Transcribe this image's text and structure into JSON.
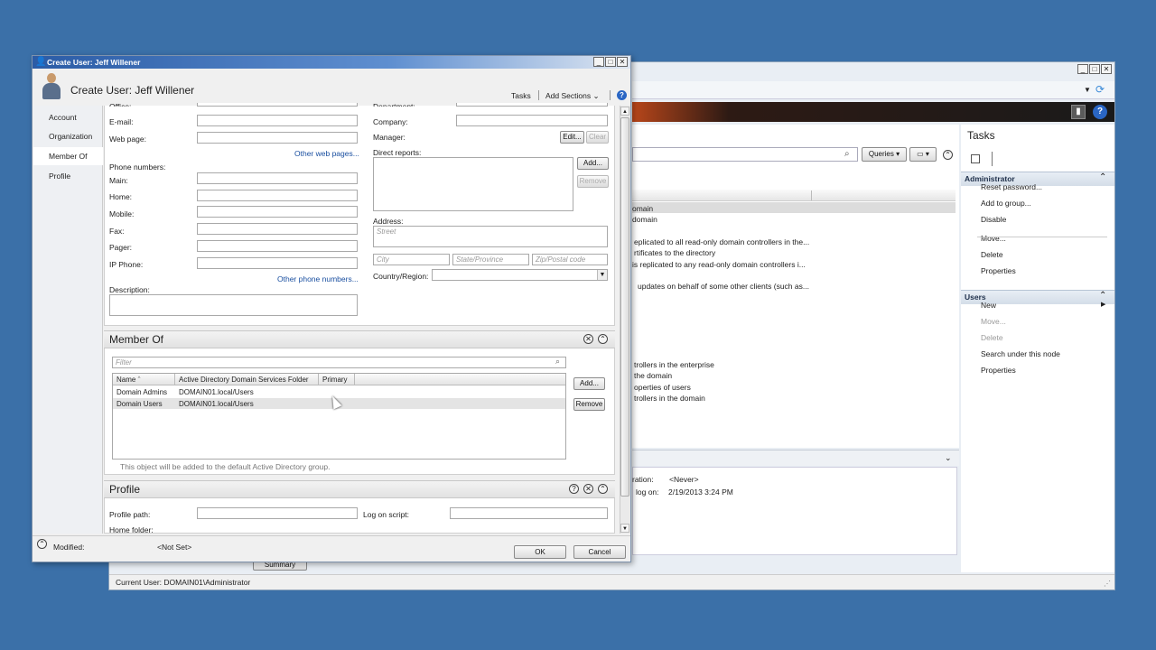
{
  "background_window": {
    "tasks_title": "Tasks",
    "search_icon": "magnifier-icon",
    "queries_label": "Queries",
    "list_items": [
      "omain",
      "domain",
      "eplicated to all read-only domain controllers in the...",
      "rtificates to the directory",
      "is replicated to any read-only domain controllers i...",
      "updates on behalf of some other clients (such as...",
      "trollers in the enterprise",
      "the domain",
      "operties of users",
      "trollers in the domain"
    ],
    "details": [
      {
        "label": "ration:",
        "value": "<Never>"
      },
      {
        "label": "log on:",
        "value": "2/19/2013 3:24 PM"
      }
    ],
    "summary_button": "Summary",
    "status_bar": "Current User: DOMAIN01\\Administrator",
    "task_groups": [
      {
        "title": "Administrator",
        "items": [
          {
            "label": "Reset password...",
            "enabled": true
          },
          {
            "label": "Add to group...",
            "enabled": true
          },
          {
            "label": "Disable",
            "enabled": true
          },
          {
            "label": "Move...",
            "enabled": true
          },
          {
            "label": "Delete",
            "enabled": true
          },
          {
            "label": "Properties",
            "enabled": true
          }
        ]
      },
      {
        "title": "Users",
        "items": [
          {
            "label": "New",
            "enabled": true
          },
          {
            "label": "Move...",
            "enabled": false
          },
          {
            "label": "Delete",
            "enabled": false
          },
          {
            "label": "Search under this node",
            "enabled": true
          },
          {
            "label": "Properties",
            "enabled": true
          }
        ]
      }
    ]
  },
  "dialog": {
    "window_title": "Create User: Jeff Willener",
    "header_title": "Create User: Jeff Willener",
    "tasks_menu": "Tasks",
    "add_sections_menu": "Add Sections",
    "nav": [
      "Account",
      "Organization",
      "Member Of",
      "Profile"
    ],
    "nav_active": "Member Of",
    "org": {
      "office_label": "Office:",
      "email_label": "E-mail:",
      "webpage_label": "Web page:",
      "other_web_pages": "Other web pages...",
      "phone_numbers_label": "Phone numbers:",
      "main_label": "Main:",
      "home_label": "Home:",
      "mobile_label": "Mobile:",
      "fax_label": "Fax:",
      "pager_label": "Pager:",
      "ipphone_label": "IP Phone:",
      "other_phone_numbers": "Other phone numbers...",
      "description_label": "Description:",
      "department_label": "Department:",
      "company_label": "Company:",
      "manager_label": "Manager:",
      "edit_button": "Edit...",
      "clear_button": "Clear",
      "direct_reports_label": "Direct reports:",
      "add_button": "Add...",
      "remove_button": "Remove",
      "address_label": "Address:",
      "street_placeholder": "Street",
      "city_placeholder": "City",
      "state_placeholder": "State/Province",
      "zip_placeholder": "Zip/Postal code",
      "country_label": "Country/Region:"
    },
    "member_of": {
      "title": "Member Of",
      "filter_placeholder": "Filter",
      "columns": [
        "Name",
        "Active Directory Domain Services Folder",
        "Primary"
      ],
      "rows": [
        {
          "name": "Domain Admins",
          "folder": "DOMAIN01.local/Users",
          "primary": ""
        },
        {
          "name": "Domain Users",
          "folder": "DOMAIN01.local/Users",
          "primary": ""
        }
      ],
      "add_button": "Add...",
      "remove_button": "Remove",
      "note": "This object will be added to the default Active Directory group."
    },
    "profile": {
      "title": "Profile",
      "profile_path_label": "Profile path:",
      "logon_script_label": "Log on script:",
      "home_folder_label": "Home folder:"
    },
    "footer": {
      "modified_label": "Modified:",
      "modified_value": "<Not Set>",
      "ok_button": "OK",
      "cancel_button": "Cancel"
    }
  }
}
